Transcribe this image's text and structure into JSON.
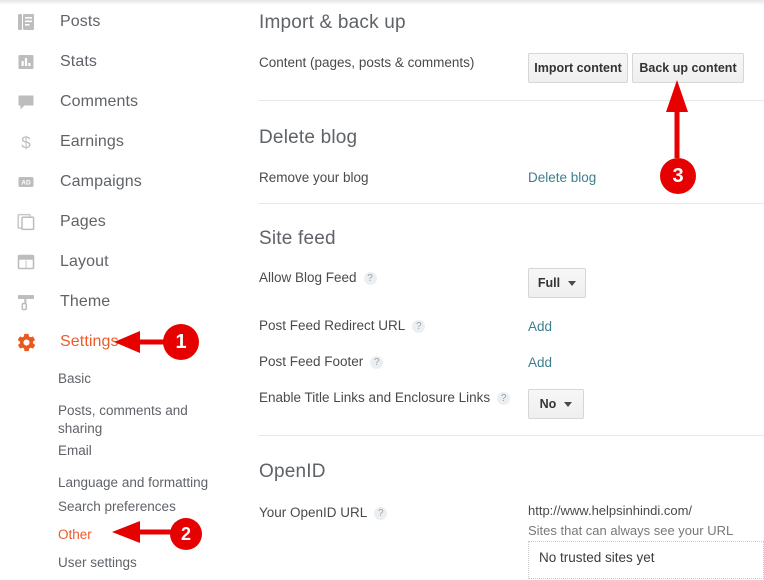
{
  "sidebar": {
    "items": [
      {
        "label": "Posts",
        "icon": "posts-icon",
        "active": false
      },
      {
        "label": "Stats",
        "icon": "stats-icon",
        "active": false
      },
      {
        "label": "Comments",
        "icon": "comments-icon",
        "active": false
      },
      {
        "label": "Earnings",
        "icon": "earnings-icon",
        "active": false
      },
      {
        "label": "Campaigns",
        "icon": "campaigns-icon",
        "active": false
      },
      {
        "label": "Pages",
        "icon": "pages-icon",
        "active": false
      },
      {
        "label": "Layout",
        "icon": "layout-icon",
        "active": false
      },
      {
        "label": "Theme",
        "icon": "theme-icon",
        "active": false
      },
      {
        "label": "Settings",
        "icon": "gear-icon",
        "active": true
      }
    ],
    "sub_items": [
      {
        "label": "Basic",
        "active": false
      },
      {
        "label": "Posts, comments and sharing",
        "active": false
      },
      {
        "label": "Email",
        "active": false
      },
      {
        "label": "Language and formatting",
        "active": false
      },
      {
        "label": "Search preferences",
        "active": false
      },
      {
        "label": "Other",
        "active": true
      },
      {
        "label": "User settings",
        "active": false
      }
    ]
  },
  "main": {
    "import_backup": {
      "title": "Import & back up",
      "row_label": "Content (pages, posts & comments)",
      "import_button": "Import content",
      "backup_button": "Back up content"
    },
    "delete_blog": {
      "title": "Delete blog",
      "row_label": "Remove your blog",
      "link": "Delete blog"
    },
    "site_feed": {
      "title": "Site feed",
      "allow_blog_feed_label": "Allow Blog Feed",
      "allow_blog_feed_value": "Full",
      "post_feed_redirect_label": "Post Feed Redirect URL",
      "post_feed_redirect_link": "Add",
      "post_feed_footer_label": "Post Feed Footer",
      "post_feed_footer_link": "Add",
      "enable_title_links_label": "Enable Title Links and Enclosure Links",
      "enable_title_links_value": "No",
      "help_glyph": "?"
    },
    "openid": {
      "title": "OpenID",
      "row_label": "Your OpenID URL",
      "url": "http://www.helpsinhindi.com/",
      "subtext": "Sites that can always see your URL",
      "trusted_sites_empty": "No trusted sites yet"
    }
  },
  "annotations": {
    "marker_1": "1",
    "marker_2": "2",
    "marker_3": "3"
  },
  "colors": {
    "accent": "#ec5b2b",
    "link": "#3d7f8c",
    "annotation": "#e60000",
    "text": "#5f6368"
  }
}
